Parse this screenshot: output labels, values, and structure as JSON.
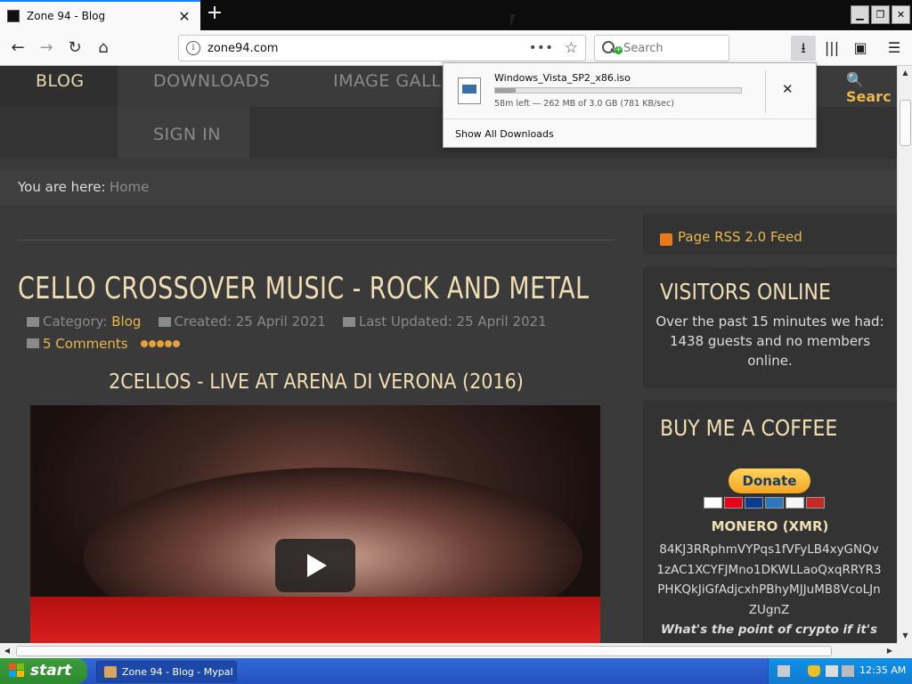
{
  "browser": {
    "tab_title": "Zone 94 - Blog",
    "url": "zone94.com",
    "search_placeholder": "Search"
  },
  "site": {
    "nav": {
      "blog": "BLOG",
      "downloads": "DOWNLOADS",
      "image_gallery": "IMAGE GALLE",
      "sign_in": "SIGN IN",
      "search": "Searc"
    },
    "breadcrumb": {
      "label": "You are here:",
      "home": "Home"
    },
    "article": {
      "title": "CELLO CROSSOVER MUSIC - ROCK AND METAL",
      "category_label": "Category:",
      "category": "Blog",
      "created": "Created: 25 April 2021",
      "updated": "Last Updated: 25 April 2021",
      "comments": "5 Comments",
      "rating": 5,
      "video_title": "2CELLOS - LIVE AT ARENA DI VERONA (2016)"
    },
    "sidebar": {
      "rss": "Page RSS 2.0 Feed",
      "visitors_title": "VISITORS ONLINE",
      "visitors_text": "Over the past 15 minutes we had: 1438 guests and no members online.",
      "coffee_title": "BUY ME A COFFEE",
      "donate": "Donate",
      "monero_title": "MONERO (XMR)",
      "xmr_address": "84KJ3RRphmVYPqs1fVFyLB4xyGNQv1zAC1XCYFJMno1DKWLLaoQxqRRYR3PHKQkJiGfAdjcxhPBhyMJJuMB8VcoLJnZUgnZ",
      "crypto_question": "What's the point of crypto if it's not private?"
    }
  },
  "downloads_panel": {
    "filename": "Windows_Vista_SP2_x86.iso",
    "status": "58m left — 262 MB of 3.0 GB (781 KB/sec)",
    "progress": 0.085,
    "show_all": "Show All Downloads"
  },
  "taskbar": {
    "start": "start",
    "task": "Zone 94 - Blog - Mypal",
    "clock": "12:35 AM"
  },
  "colors": {
    "accent": "#e8b84a",
    "heading": "#f0dfb5",
    "taskbar": "#2452c0",
    "start": "#2e8a2e"
  }
}
